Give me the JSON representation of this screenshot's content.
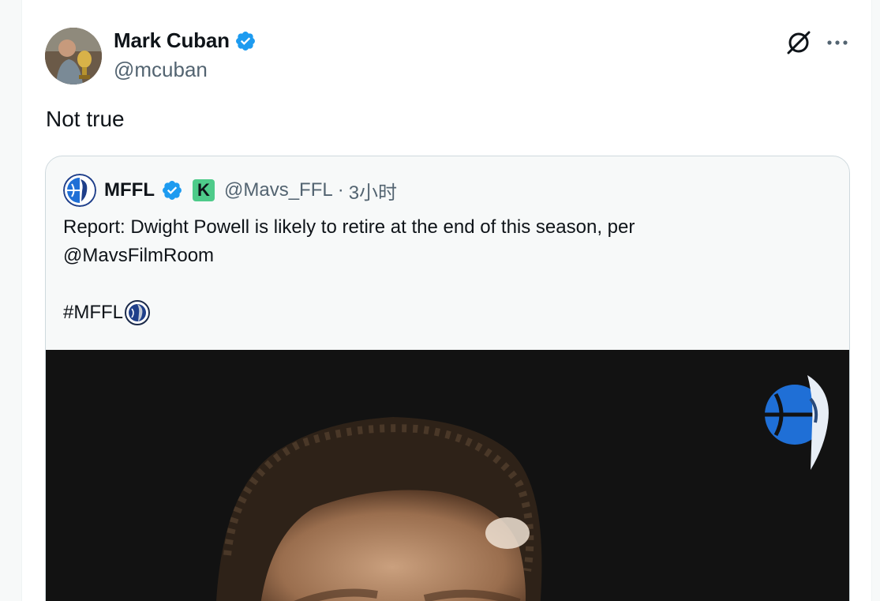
{
  "tweet": {
    "author": {
      "name": "Mark Cuban",
      "handle": "@mcuban",
      "verified": true
    },
    "text": "Not true",
    "icons": [
      "grok-icon",
      "more-icon"
    ],
    "quoted": {
      "author": {
        "name": "MFFL",
        "handle": "@Mavs_FFL",
        "badge_letter": "K",
        "verified": true
      },
      "separator": "·",
      "time": "3小时",
      "text_line1": "Report: Dwight Powell is likely to retire at the end of this season, per",
      "mention": "@MavsFilmRoom",
      "hashtag": "#MFFL"
    }
  },
  "colors": {
    "verified_blue": "#1d9bf0",
    "secondary_text": "#536471",
    "badge_green": "#4ecb8a",
    "mavs_blue": "#1f6fd6"
  }
}
